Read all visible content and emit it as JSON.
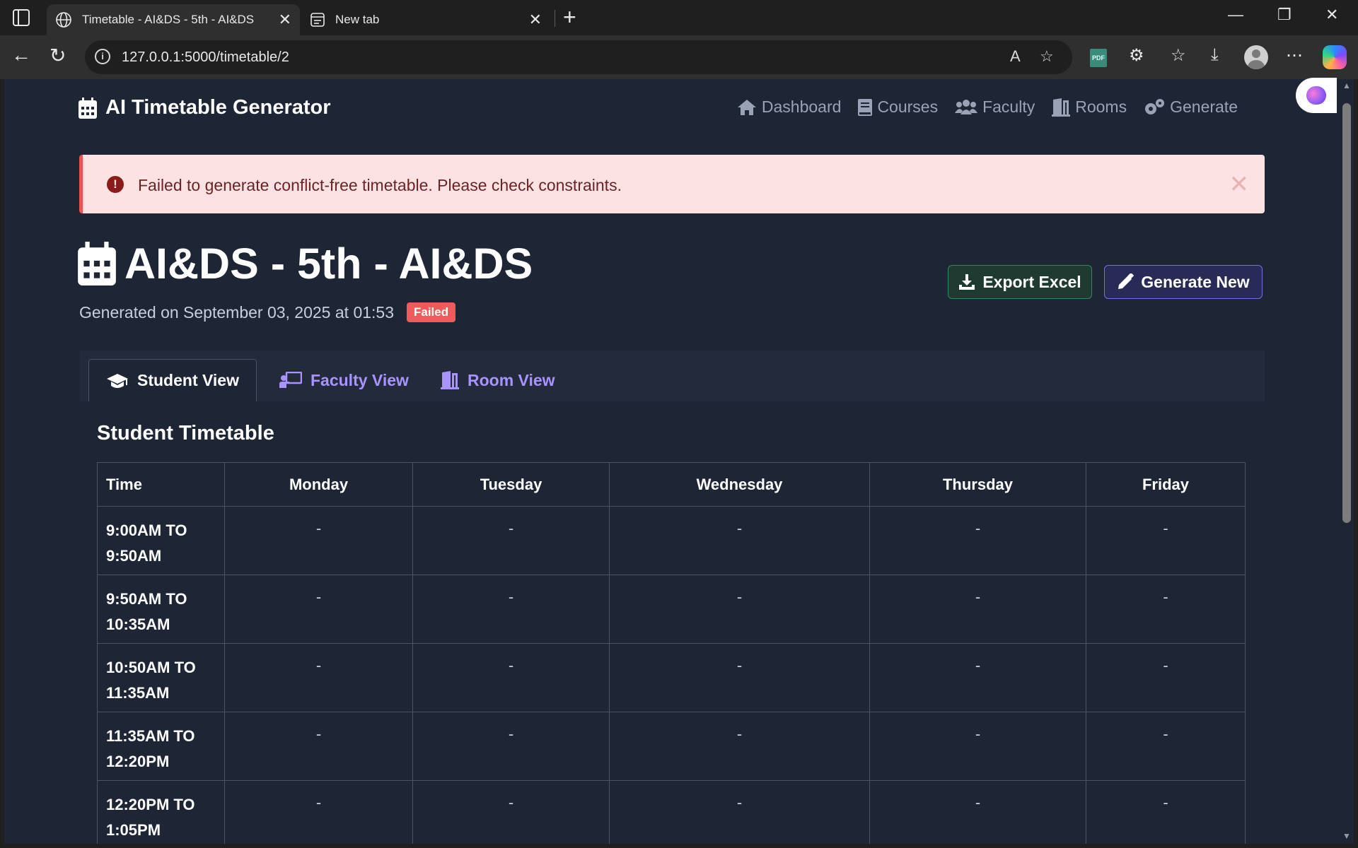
{
  "browser": {
    "tabs": [
      {
        "title": "Timetable - AI&DS - 5th - AI&DS",
        "active": true
      },
      {
        "title": "New tab",
        "active": false
      }
    ],
    "url": "127.0.0.1:5000/timetable/2"
  },
  "navbar": {
    "brand": "AI Timetable Generator",
    "links": [
      {
        "label": "Dashboard",
        "icon": "home-icon"
      },
      {
        "label": "Courses",
        "icon": "book-icon"
      },
      {
        "label": "Faculty",
        "icon": "users-icon"
      },
      {
        "label": "Rooms",
        "icon": "door-icon"
      },
      {
        "label": "Generate",
        "icon": "gears-icon"
      }
    ]
  },
  "alert": {
    "message": "Failed to generate conflict-free timetable. Please check constraints.",
    "color": "#fde2e3"
  },
  "header": {
    "title": "AI&DS - 5th - AI&DS",
    "generated": "Generated on September 03, 2025 at 01:53",
    "status": "Failed",
    "status_color": "#ef5b5b"
  },
  "actions": {
    "export_label": "Export Excel",
    "generate_label": "Generate New"
  },
  "view_tabs": [
    {
      "label": "Student View",
      "active": true
    },
    {
      "label": "Faculty View",
      "active": false
    },
    {
      "label": "Room View",
      "active": false
    }
  ],
  "section_title": "Student Timetable",
  "table": {
    "columns": [
      "Time",
      "Monday",
      "Tuesday",
      "Wednesday",
      "Thursday",
      "Friday"
    ],
    "rows": [
      {
        "time": "9:00AM TO 9:50AM",
        "cells": [
          "-",
          "-",
          "-",
          "-",
          "-"
        ]
      },
      {
        "time": "9:50AM TO 10:35AM",
        "cells": [
          "-",
          "-",
          "-",
          "-",
          "-"
        ]
      },
      {
        "time": "10:50AM TO 11:35AM",
        "cells": [
          "-",
          "-",
          "-",
          "-",
          "-"
        ]
      },
      {
        "time": "11:35AM TO 12:20PM",
        "cells": [
          "-",
          "-",
          "-",
          "-",
          "-"
        ]
      },
      {
        "time": "12:20PM TO 1:05PM",
        "cells": [
          "-",
          "-",
          "-",
          "-",
          "-"
        ]
      }
    ]
  },
  "colors": {
    "page_bg": "#1e2535",
    "accent": "#a994ff",
    "success": "#2e8a58"
  }
}
